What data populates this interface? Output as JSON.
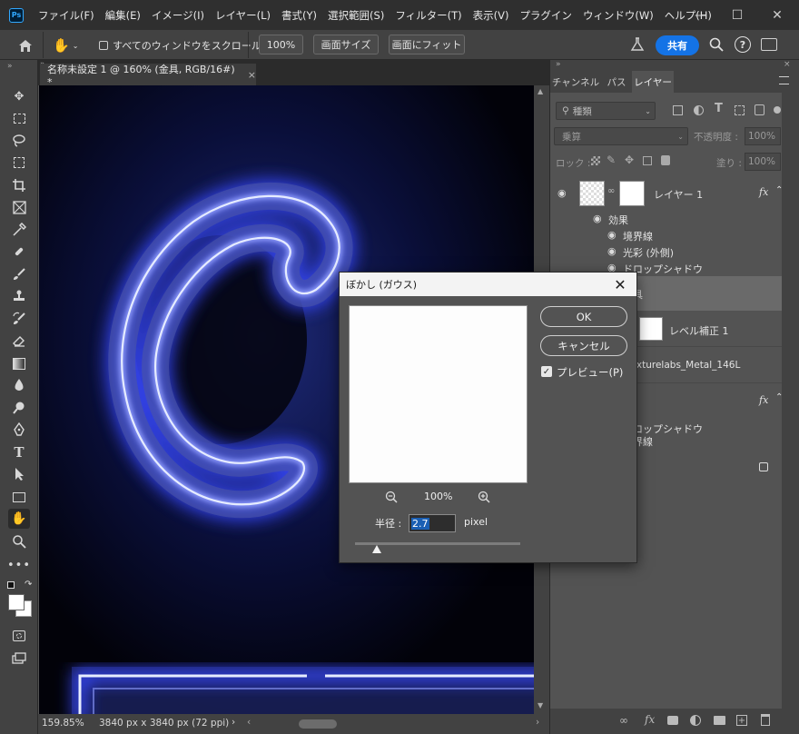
{
  "menubar": {
    "logo": "Ps",
    "items": [
      "ファイル(F)",
      "編集(E)",
      "イメージ(I)",
      "レイヤー(L)",
      "書式(Y)",
      "選択範囲(S)",
      "フィルター(T)",
      "表示(V)",
      "プラグイン",
      "ウィンドウ(W)",
      "ヘルプ(H)"
    ]
  },
  "options": {
    "scroll_all_label": "すべてのウィンドウをスクロール",
    "zoom_value": "100%",
    "fit_screen_label": "画面サイズ",
    "fill_screen_label": "画面にフィット",
    "share_label": "共有"
  },
  "document": {
    "tab_title": "名称未設定 1 @ 160% (金具, RGB/16#) *",
    "zoom": "159.85%",
    "size_info": "3840 px x 3840 px (72 ppi)"
  },
  "panel": {
    "tabs": [
      "チャンネル",
      "パス",
      "レイヤー"
    ],
    "active_tab": "レイヤー",
    "filter_kind": "種類",
    "blend_mode": "乗算",
    "opacity_label": "不透明度 :",
    "opacity_value": "100%",
    "lock_label": "ロック :",
    "fill_label": "塗り :",
    "fill_value": "100%",
    "layers": [
      {
        "name": "レイヤー 1",
        "fx": "fx"
      },
      {
        "name": "効果"
      },
      {
        "name": "境界線"
      },
      {
        "name": "光彩 (外側)"
      },
      {
        "name": "ドロップシャドウ"
      },
      {
        "name": "金具"
      },
      {
        "name": "レベル補正 1"
      },
      {
        "name": "Texturelabs_Metal_146L"
      },
      {
        "name": "ドロップシャドウ"
      },
      {
        "name": "境界線"
      }
    ]
  },
  "dialog": {
    "title": "ぼかし (ガウス)",
    "ok_label": "OK",
    "cancel_label": "キャンセル",
    "preview_label": "プレビュー(P)",
    "preview_checked": true,
    "zoom_value": "100%",
    "radius_label": "半径 :",
    "radius_value": "2.7",
    "radius_unit": "pixel",
    "slider_fraction": 0.13
  },
  "colors": {
    "accent": "#1473e6",
    "neon": "#5b6dff",
    "canvas_bg": "#03030c"
  }
}
